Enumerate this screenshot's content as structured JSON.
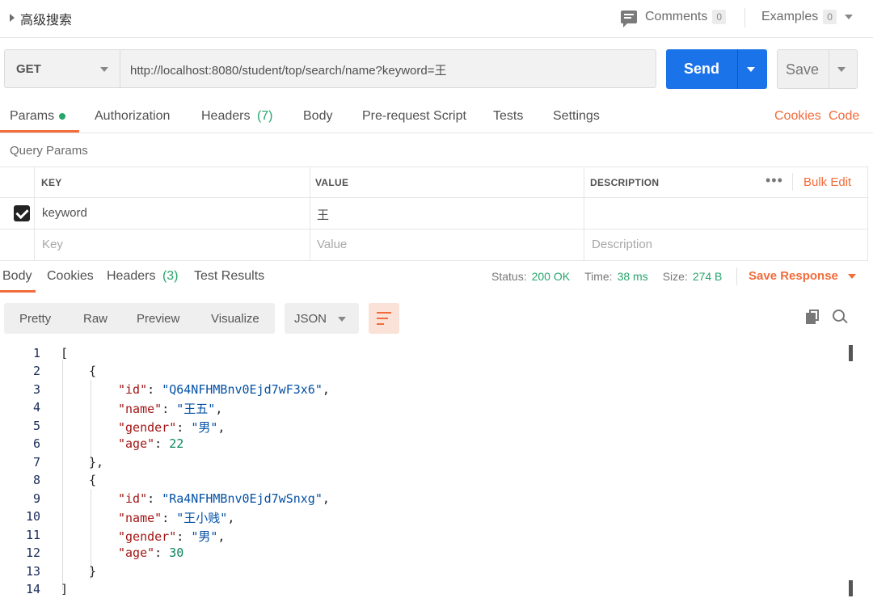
{
  "topbar": {
    "title": "高级搜索",
    "comments_label": "Comments",
    "comments_count": "0",
    "examples_label": "Examples",
    "examples_count": "0"
  },
  "request": {
    "method": "GET",
    "url": "http://localhost:8080/student/top/search/name?keyword=王",
    "send_label": "Send",
    "save_label": "Save"
  },
  "tabs": {
    "params": "Params",
    "authorization": "Authorization",
    "headers": "Headers",
    "headers_count": "(7)",
    "body": "Body",
    "prerequest": "Pre-request Script",
    "tests": "Tests",
    "settings": "Settings",
    "cookies": "Cookies",
    "code": "Code"
  },
  "query": {
    "title": "Query Params",
    "columns": {
      "key": "KEY",
      "value": "VALUE",
      "description": "DESCRIPTION"
    },
    "bulk_edit": "Bulk Edit",
    "rows": [
      {
        "key": "keyword",
        "value": "王",
        "description": "",
        "checked": true
      }
    ],
    "placeholders": {
      "key": "Key",
      "value": "Value",
      "description": "Description"
    }
  },
  "response": {
    "tabs": {
      "body": "Body",
      "cookies": "Cookies",
      "headers": "Headers",
      "headers_count": "(3)",
      "test_results": "Test Results"
    },
    "status_label": "Status:",
    "status_value": "200 OK",
    "time_label": "Time:",
    "time_value": "38 ms",
    "size_label": "Size:",
    "size_value": "274 B",
    "save_response": "Save Response",
    "views": {
      "pretty": "Pretty",
      "raw": "Raw",
      "preview": "Preview",
      "visualize": "Visualize"
    },
    "format": "JSON"
  },
  "json_body": [
    {
      "id": "Q64NFHMBnv0Ejd7wF3x6",
      "name": "王五",
      "gender": "男",
      "age": 22
    },
    {
      "id": "Ra4NFHMBnv0Ejd7wSnxg",
      "name": "王小贱",
      "gender": "男",
      "age": 30
    }
  ],
  "line_numbers": [
    "1",
    "2",
    "3",
    "4",
    "5",
    "6",
    "7",
    "8",
    "9",
    "10",
    "11",
    "12",
    "13",
    "14"
  ]
}
